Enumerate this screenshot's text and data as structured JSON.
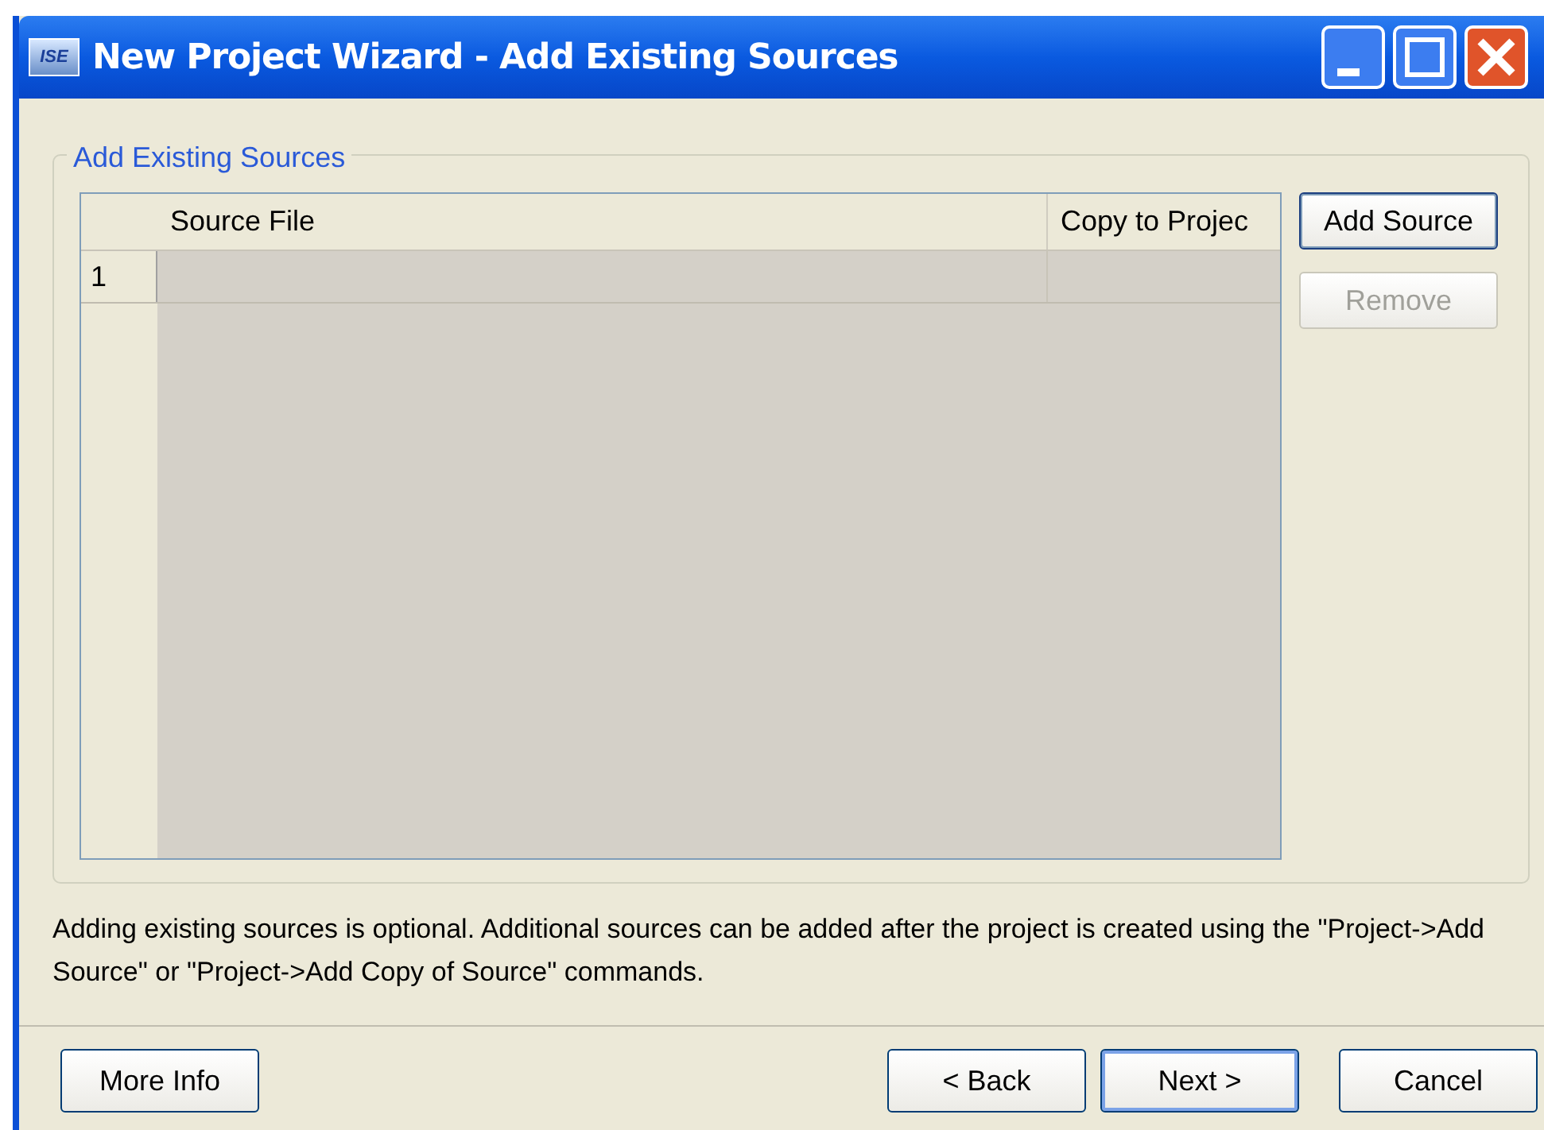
{
  "window": {
    "title": "New Project Wizard - Add Existing Sources",
    "app_icon_text": "ISE"
  },
  "group": {
    "title": "Add Existing Sources"
  },
  "table": {
    "columns": [
      "Source File",
      "Copy to Projec"
    ],
    "rows": [
      {
        "number": "1"
      }
    ]
  },
  "side_buttons": [
    {
      "label": "Add Source",
      "disabled": false,
      "focused": true
    },
    {
      "label": "Remove",
      "disabled": true,
      "focused": false
    }
  ],
  "note": "Adding existing sources is optional. Additional sources can be added after the project is created using the \"Project->Add Source\" or \"Project->Add Copy of Source\" commands.",
  "footer_buttons": [
    {
      "label": "More Info",
      "default": false
    },
    {
      "label": "< Back",
      "default": false
    },
    {
      "label": "Next >",
      "default": true
    },
    {
      "label": "Cancel",
      "default": false
    }
  ]
}
